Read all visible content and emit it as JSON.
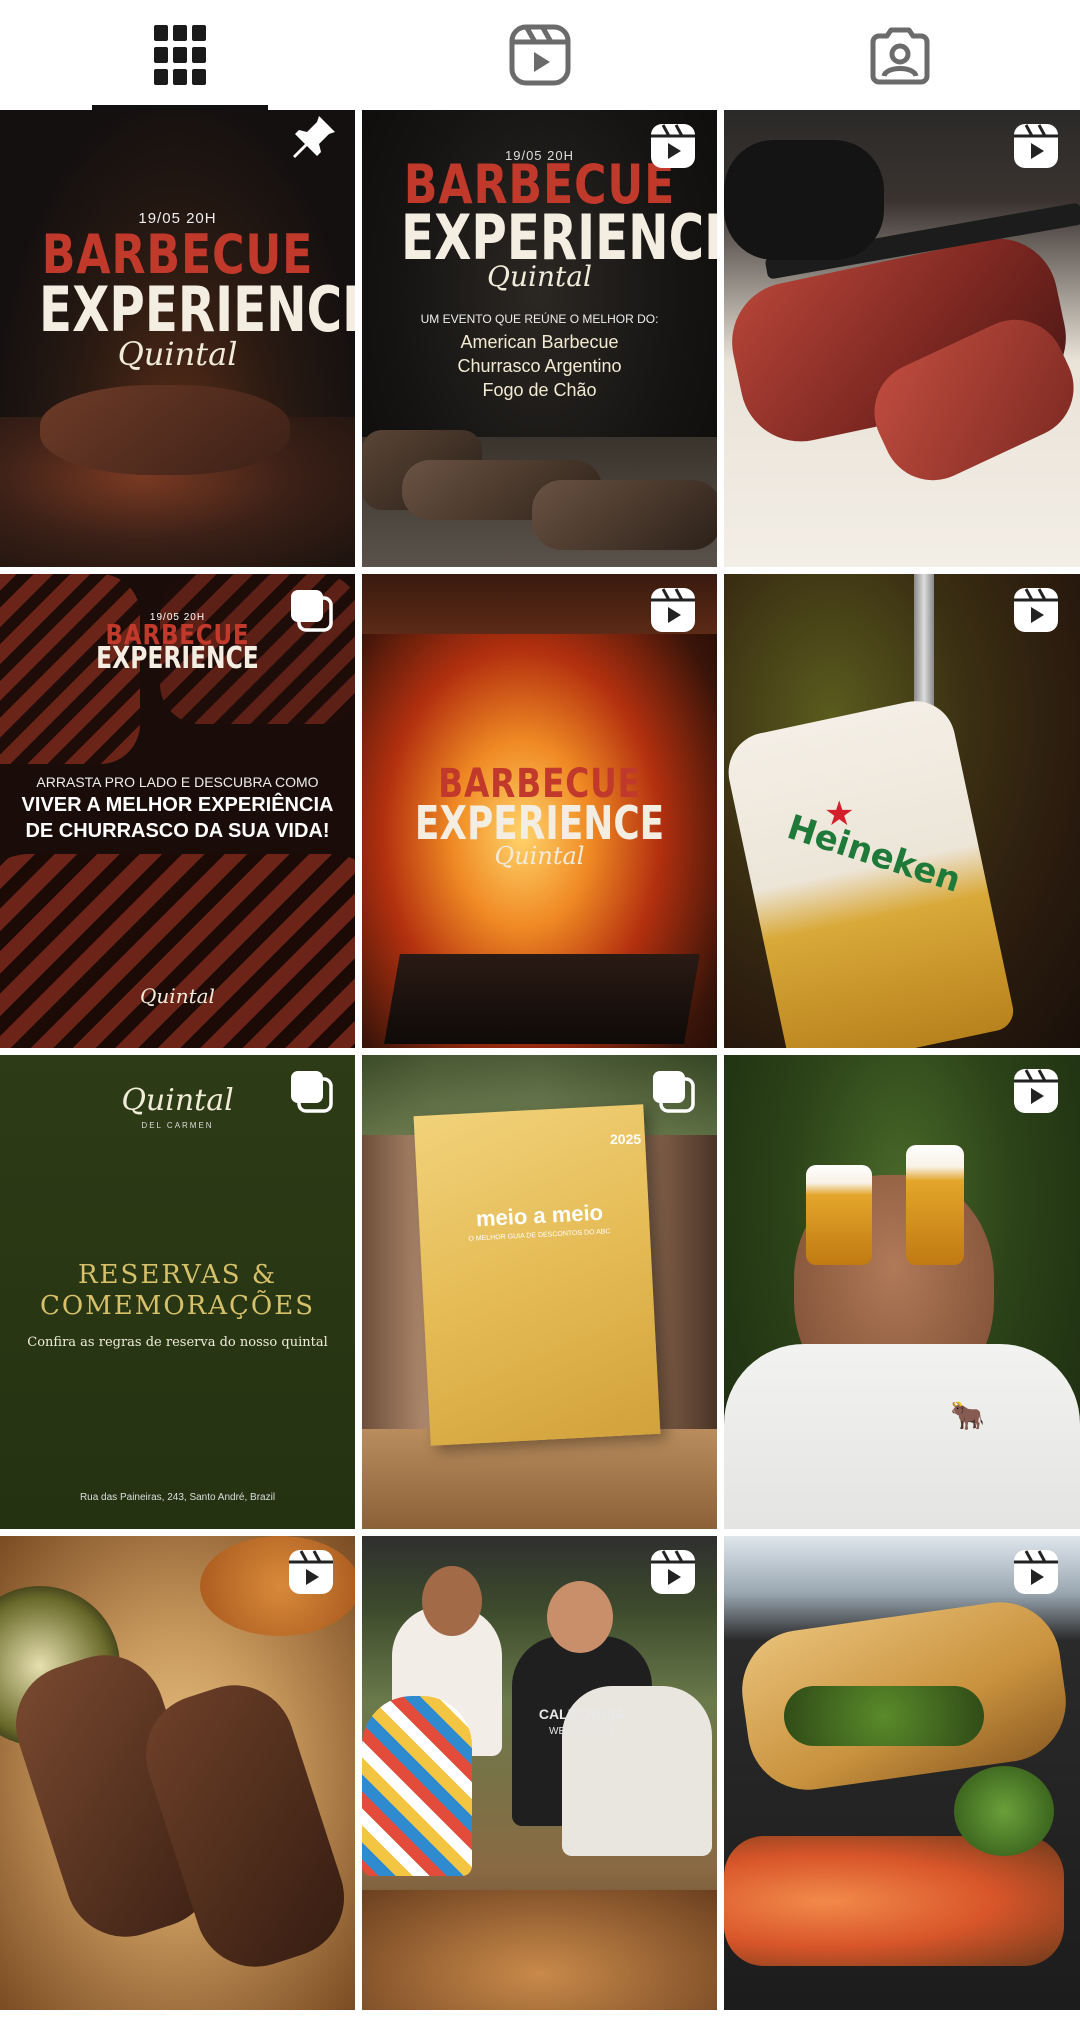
{
  "tabs": [
    {
      "name": "posts",
      "icon": "grid-icon",
      "active": true
    },
    {
      "name": "reels",
      "icon": "reels-icon",
      "active": false
    },
    {
      "name": "tagged",
      "icon": "tagged-person-icon",
      "active": false
    }
  ],
  "posts": {
    "p1": {
      "date": "19/05 20H",
      "title_line1": "BARBECUE",
      "title_line2": "EXPERIENCE",
      "brand": "Quintal",
      "badge": "pin-icon"
    },
    "p2": {
      "date": "19/05 20H",
      "title_line1": "BARBECUE",
      "title_line2": "EXPERIENCE",
      "brand": "Quintal",
      "subtitle": "UM EVENTO QUE REÚNE O MELHOR DO:",
      "items": [
        "American Barbecue",
        "Churrasco Argentino",
        "Fogo de Chão"
      ],
      "badge": "reel-icon"
    },
    "p3": {
      "badge": "reel-icon"
    },
    "p4": {
      "date": "19/05 20H",
      "title_line1": "BARBECUE",
      "title_line2": "EXPERIENCE",
      "caption1": "ARRASTA PRO LADO E DESCUBRA COMO",
      "caption2": "VIVER A MELHOR EXPERIÊNCIA",
      "caption3": "DE CHURRASCO DA SUA VIDA!",
      "brand": "Quintal",
      "badge": "carousel-icon"
    },
    "p5": {
      "title_line1": "BARBECUE",
      "title_line2": "EXPERIENCE",
      "brand": "Quintal",
      "badge": "reel-icon"
    },
    "p6": {
      "product": "Heineken",
      "badge": "reel-icon"
    },
    "p7": {
      "brand": "Quintal",
      "brand_sub": "DEL CARMEN",
      "title1": "RESERVAS &",
      "title2": "COMEMORAÇÕES",
      "subtitle": "Confira as regras de reserva do nosso quintal",
      "address": "Rua das Paineiras, 243, Santo André, Brazil",
      "badge": "carousel-icon"
    },
    "p8": {
      "year": "2025",
      "logo": "meio a meio",
      "tagline": "O MELHOR GUIA DE DESCONTOS DO ABC",
      "badge": "carousel-icon"
    },
    "p9": {
      "badge": "reel-icon"
    },
    "p10": {
      "badge": "reel-icon"
    },
    "p11": {
      "shirt1": "CALIFORNIA",
      "shirt2": "WEST COAST",
      "badge": "reel-icon"
    },
    "p12": {
      "badge": "reel-icon"
    }
  },
  "colors": {
    "accent": "#111111",
    "icon_gray": "#6b6b6b",
    "reserve_bg": "#2e3d17",
    "gold": "#d7c06a"
  }
}
